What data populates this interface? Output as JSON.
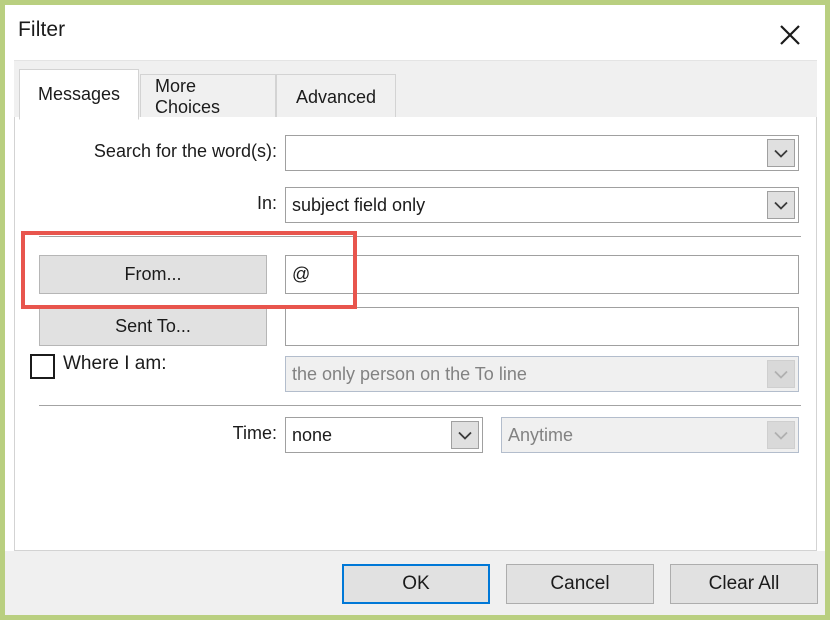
{
  "window": {
    "title": "Filter",
    "close_icon": "close-icon"
  },
  "tabs": [
    {
      "label": "Messages",
      "selected": true
    },
    {
      "label": "More Choices",
      "selected": false
    },
    {
      "label": "Advanced",
      "selected": false
    }
  ],
  "form": {
    "search_words": {
      "label": "Search for the word(s):",
      "value": "",
      "arrow_icon": "chevron-down-icon"
    },
    "in_field": {
      "label": "In:",
      "value": "subject field only",
      "arrow_icon": "chevron-down-icon"
    },
    "from": {
      "button_label": "From...",
      "value": "@"
    },
    "sent_to": {
      "button_label": "Sent To...",
      "value": ""
    },
    "where_i_am": {
      "label": "Where I am:",
      "checked": false,
      "value": "the only person on the To line",
      "enabled": false,
      "arrow_icon": "chevron-down-icon"
    },
    "time": {
      "label": "Time:",
      "condition_value": "none",
      "range_value": "Anytime",
      "range_enabled": false,
      "arrow_icon": "chevron-down-icon"
    }
  },
  "footer": {
    "ok_label": "OK",
    "cancel_label": "Cancel",
    "clear_all_label": "Clear All"
  },
  "annotation": {
    "highlight_color": "#e8554d",
    "target": "from-row"
  },
  "colors": {
    "frame_border": "#b9cf80",
    "default_button_border": "#0078d7",
    "panel_background": "#ffffff",
    "chrome_background": "#f0f0f0"
  }
}
